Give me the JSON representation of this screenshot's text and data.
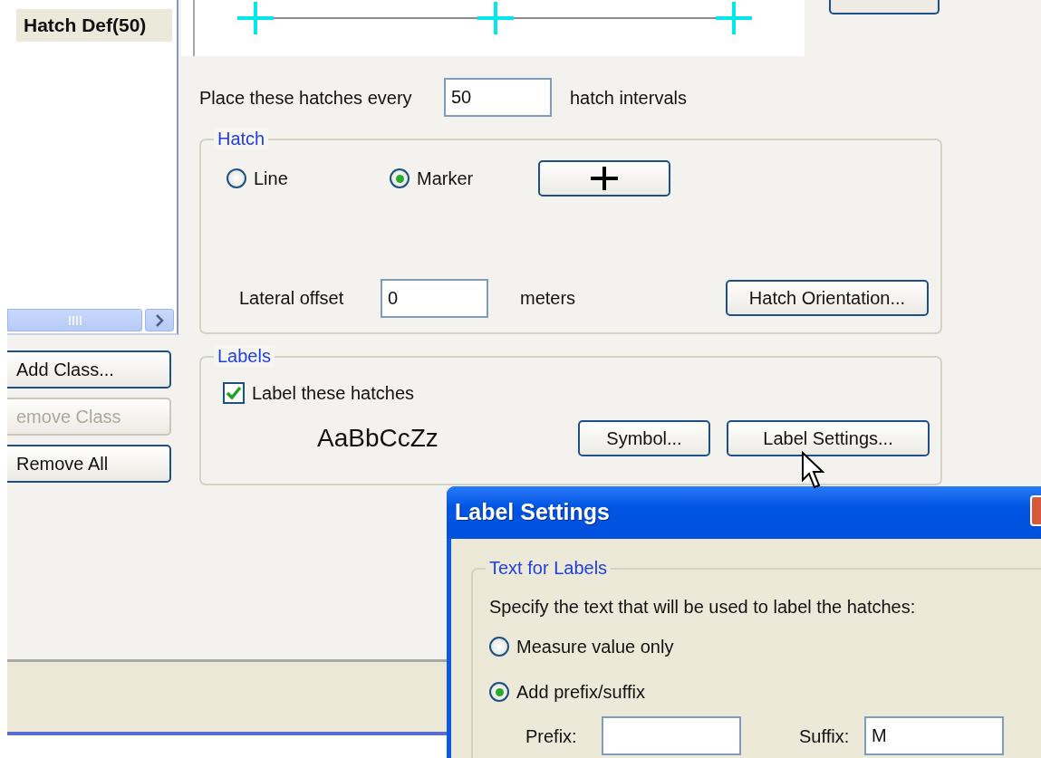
{
  "class_list": {
    "items": [
      {
        "label": "Hatch Def(50)",
        "selected": true
      }
    ]
  },
  "class_buttons": [
    {
      "label": "Add Class...",
      "disabled": false
    },
    {
      "label": "emove Class",
      "disabled": true
    },
    {
      "label": "Remove All",
      "disabled": false
    }
  ],
  "interval": {
    "label": "Place these hatches every",
    "value": "50",
    "unit": "hatch intervals"
  },
  "hatch_group": {
    "title": "Hatch",
    "options": [
      {
        "label": "Line",
        "selected": false
      },
      {
        "label": "Marker",
        "selected": true
      }
    ],
    "lateral_offset": {
      "label": "Lateral offset",
      "value": "0",
      "unit": "meters"
    },
    "orientation_button": "Hatch Orientation..."
  },
  "labels_group": {
    "title": "Labels",
    "label_hatches": {
      "label": "Label these hatches",
      "checked": true
    },
    "sample": "AaBbCcZz",
    "buttons": [
      "Symbol...",
      "Label Settings..."
    ]
  },
  "label_settings_dialog": {
    "title": "Label Settings",
    "group_title": "Text for Labels",
    "instruction": "Specify the text that will be used to label the hatches:",
    "options": [
      {
        "label": "Measure value only",
        "selected": false
      },
      {
        "label": "Add prefix/suffix",
        "selected": true
      }
    ],
    "prefix": {
      "label": "Prefix:"
    },
    "suffix": {
      "label": "Suffix:",
      "value": "M"
    }
  }
}
